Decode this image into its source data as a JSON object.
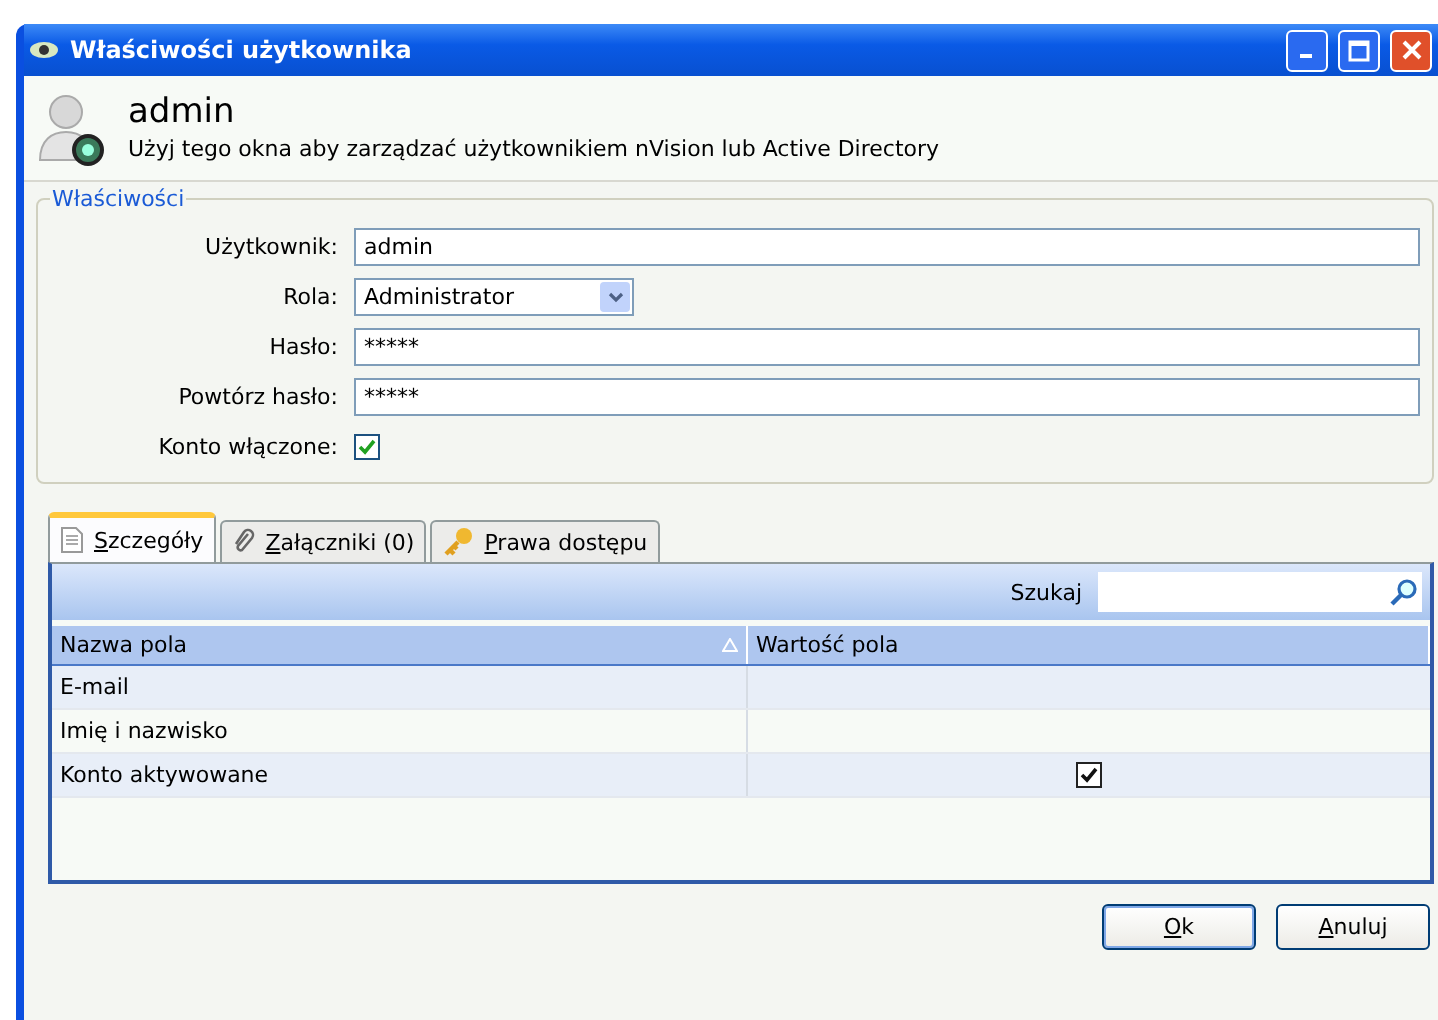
{
  "window": {
    "title": "Właściwości użytkownika"
  },
  "header": {
    "title": "admin",
    "description": "Użyj tego okna aby zarządzać użytkownikiem nVision lub Active Directory"
  },
  "properties": {
    "legend": "Właściwości",
    "fields": [
      {
        "kind": "text",
        "label": "Użytkownik:",
        "value": "admin"
      },
      {
        "kind": "select",
        "label": "Rola:",
        "value": "Administrator"
      },
      {
        "kind": "text",
        "label": "Hasło:",
        "value": "*****"
      },
      {
        "kind": "text",
        "label": "Powtórz hasło:",
        "value": "*****"
      },
      {
        "kind": "checkbox",
        "label": "Konto włączone:",
        "checked": true
      }
    ]
  },
  "tabs": [
    {
      "label": "Szczegóły",
      "kind": "page",
      "selected": true
    },
    {
      "label": "Załączniki (0)",
      "kind": "clip",
      "selected": false
    },
    {
      "label": "Prawa dostępu",
      "kind": "key",
      "selected": false
    }
  ],
  "search": {
    "label": "Szukaj"
  },
  "table": {
    "columns": [
      {
        "label": "Nazwa pola",
        "sorted": true
      },
      {
        "label": "Wartość pola",
        "sorted": false
      }
    ],
    "rows": [
      {
        "name": "E-mail",
        "kind": "text"
      },
      {
        "name": "Imię i nazwisko",
        "kind": "text"
      },
      {
        "name": "Konto aktywowane",
        "kind": "checkbox",
        "checked": true
      }
    ]
  },
  "buttons": [
    "Ok",
    "Anuluj"
  ]
}
